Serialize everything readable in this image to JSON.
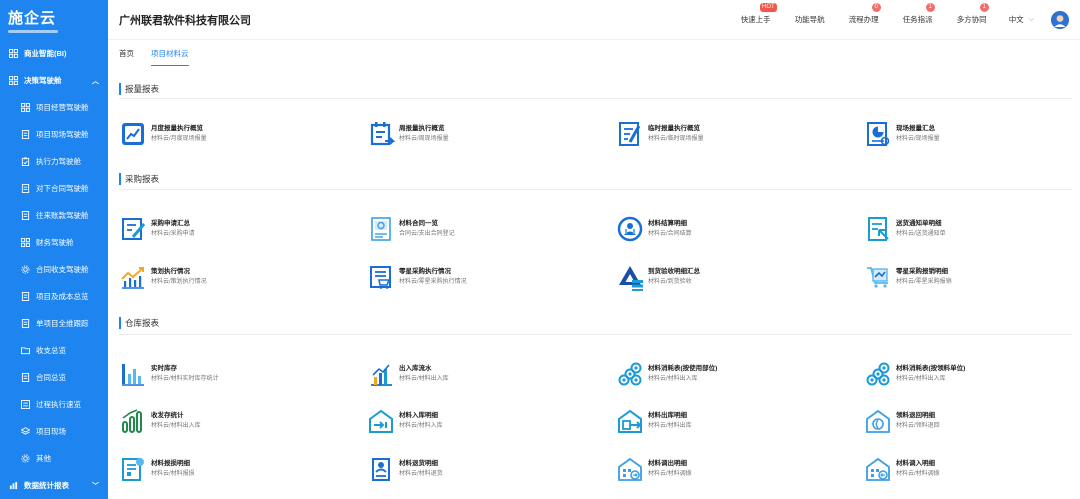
{
  "app": {
    "logo_text": "施企云",
    "company_name": "广州联君软件科技有限公司"
  },
  "sidebar": {
    "items": [
      {
        "label": "商业智能(BI)",
        "icon": "grid-icon",
        "level": "top"
      },
      {
        "label": "决策驾驶舱",
        "icon": "grid-icon",
        "level": "top",
        "expanded": true
      },
      {
        "label": "项目经营驾驶舱",
        "icon": "grid-icon",
        "level": "sub"
      },
      {
        "label": "项目现场驾驶舱",
        "icon": "document-icon",
        "level": "sub"
      },
      {
        "label": "执行力驾驶舱",
        "icon": "clipboard-icon",
        "level": "sub"
      },
      {
        "label": "对下合同驾驶舱",
        "icon": "document-icon",
        "level": "sub"
      },
      {
        "label": "往来账款驾驶舱",
        "icon": "document-icon",
        "level": "sub"
      },
      {
        "label": "财务驾驶舱",
        "icon": "grid-icon",
        "level": "sub"
      },
      {
        "label": "合同收支驾驶舱",
        "icon": "gear-icon",
        "level": "sub"
      },
      {
        "label": "项目及成本总览",
        "icon": "document-icon",
        "level": "sub"
      },
      {
        "label": "单项目全维跟踪",
        "icon": "document-icon",
        "level": "sub"
      },
      {
        "label": "收支总览",
        "icon": "folder-icon",
        "level": "sub"
      },
      {
        "label": "合同总览",
        "icon": "document-icon",
        "level": "sub"
      },
      {
        "label": "过程执行速览",
        "icon": "list-icon",
        "level": "sub"
      },
      {
        "label": "项目现场",
        "icon": "layers-icon",
        "level": "sub"
      },
      {
        "label": "其他",
        "icon": "gear-icon",
        "level": "sub"
      },
      {
        "label": "数据统计报表",
        "icon": "chart-icon",
        "level": "top"
      }
    ]
  },
  "header": {
    "nav": [
      {
        "label": "快速上手",
        "badge": "HOT"
      },
      {
        "label": "功能导航",
        "badge": ""
      },
      {
        "label": "流程办理",
        "badge": "0"
      },
      {
        "label": "任务指派",
        "badge": "1"
      },
      {
        "label": "多方协同",
        "badge": "1"
      }
    ],
    "language": "中文"
  },
  "tabs": [
    {
      "label": "首页",
      "active": false
    },
    {
      "label": "项目材料云",
      "active": true
    }
  ],
  "sections": [
    {
      "title": "报量报表",
      "cards": [
        {
          "title": "月度报量执行概览",
          "sub": "材料云/月度现场报量",
          "icon": "monthly-report-icon"
        },
        {
          "title": "周报量执行概览",
          "sub": "材料云/周现场报量",
          "icon": "weekly-report-icon"
        },
        {
          "title": "临时报量执行概览",
          "sub": "材料云/临时现场报量",
          "icon": "temp-report-icon"
        },
        {
          "title": "现场报量汇总",
          "sub": "材料云/现场报量",
          "icon": "site-summary-icon"
        }
      ]
    },
    {
      "title": "采购报表",
      "cards": [
        {
          "title": "采购申请汇总",
          "sub": "材料云/采购申请",
          "icon": "purchase-request-icon"
        },
        {
          "title": "材料合同一览",
          "sub": "合同云/支出合同登记",
          "icon": "contract-icon"
        },
        {
          "title": "材料结算明细",
          "sub": "材料云/合同结算",
          "icon": "settlement-icon"
        },
        {
          "title": "送货通知单明细",
          "sub": "材料云/送货通知单",
          "icon": "delivery-notice-icon"
        },
        {
          "title": "策划执行情况",
          "sub": "材料云/策划执行情况",
          "icon": "trend-chart-icon"
        },
        {
          "title": "零星采购执行情况",
          "sub": "材料云/零星采购执行情况",
          "icon": "sporadic-purchase-icon"
        },
        {
          "title": "到货验收明细汇总",
          "sub": "材料云/到货验收",
          "icon": "acceptance-icon"
        },
        {
          "title": "零星采购报销明细",
          "sub": "材料云/零星采购报销",
          "icon": "reimbursement-icon"
        }
      ]
    },
    {
      "title": "仓库报表",
      "cards": [
        {
          "title": "实时库存",
          "sub": "材料云/材料实时库存统计",
          "icon": "bar-chart-icon"
        },
        {
          "title": "出入库流水",
          "sub": "材料云/材料出入库",
          "icon": "inout-flow-icon"
        },
        {
          "title": "材料消耗表(按使用部位)",
          "sub": "材料云/材料出入库",
          "icon": "pipes-icon"
        },
        {
          "title": "材料消耗表(按领料单位)",
          "sub": "材料云/材料出入库",
          "icon": "pipes-icon"
        },
        {
          "title": "收发存统计",
          "sub": "材料云/材料出入库",
          "icon": "stock-stats-icon"
        },
        {
          "title": "材料入库明细",
          "sub": "材料云/材料入库",
          "icon": "warehouse-in-icon"
        },
        {
          "title": "材料出库明细",
          "sub": "材料云/材料出库",
          "icon": "warehouse-out-icon"
        },
        {
          "title": "领料退回明细",
          "sub": "材料云/领料退回",
          "icon": "return-icon"
        },
        {
          "title": "材料报损明细",
          "sub": "材料云/材料报损",
          "icon": "loss-report-icon"
        },
        {
          "title": "材料退货明细",
          "sub": "材料云/材料退货",
          "icon": "goods-return-icon"
        },
        {
          "title": "材料调出明细",
          "sub": "材料云/材料调拨",
          "icon": "transfer-out-icon"
        },
        {
          "title": "材料调入明细",
          "sub": "材料云/材料调拨",
          "icon": "transfer-in-icon"
        }
      ]
    }
  ],
  "colors": {
    "primary": "#1d84f0",
    "sidebar": "#1d84f0",
    "icon_blue": "#1a6fd6",
    "badge": "#f36d6d"
  }
}
